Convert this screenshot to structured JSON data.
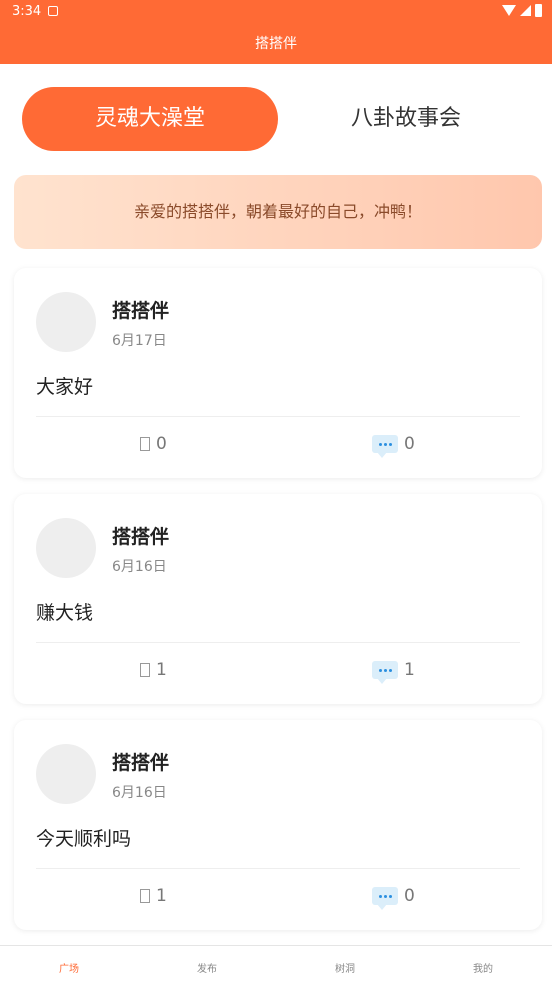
{
  "status": {
    "time": "3:34"
  },
  "header": {
    "title": "搭搭伴"
  },
  "tabs": [
    {
      "label": "灵魂大澡堂",
      "active": true
    },
    {
      "label": "八卦故事会",
      "active": false
    }
  ],
  "banner": {
    "text": "亲爱的搭搭伴，朝着最好的自己，冲鸭！"
  },
  "posts": [
    {
      "username": "搭搭伴",
      "date": "6月17日",
      "content": "大家好",
      "likes": "0",
      "comments": "0"
    },
    {
      "username": "搭搭伴",
      "date": "6月16日",
      "content": "赚大钱",
      "likes": "1",
      "comments": "1"
    },
    {
      "username": "搭搭伴",
      "date": "6月16日",
      "content": "今天顺利吗",
      "likes": "1",
      "comments": "0"
    }
  ],
  "bottom_nav": [
    {
      "label": "广场",
      "active": true
    },
    {
      "label": "发布",
      "active": false
    },
    {
      "label": "树洞",
      "active": false
    },
    {
      "label": "我的",
      "active": false
    }
  ],
  "colors": {
    "accent": "#ff6a35"
  }
}
